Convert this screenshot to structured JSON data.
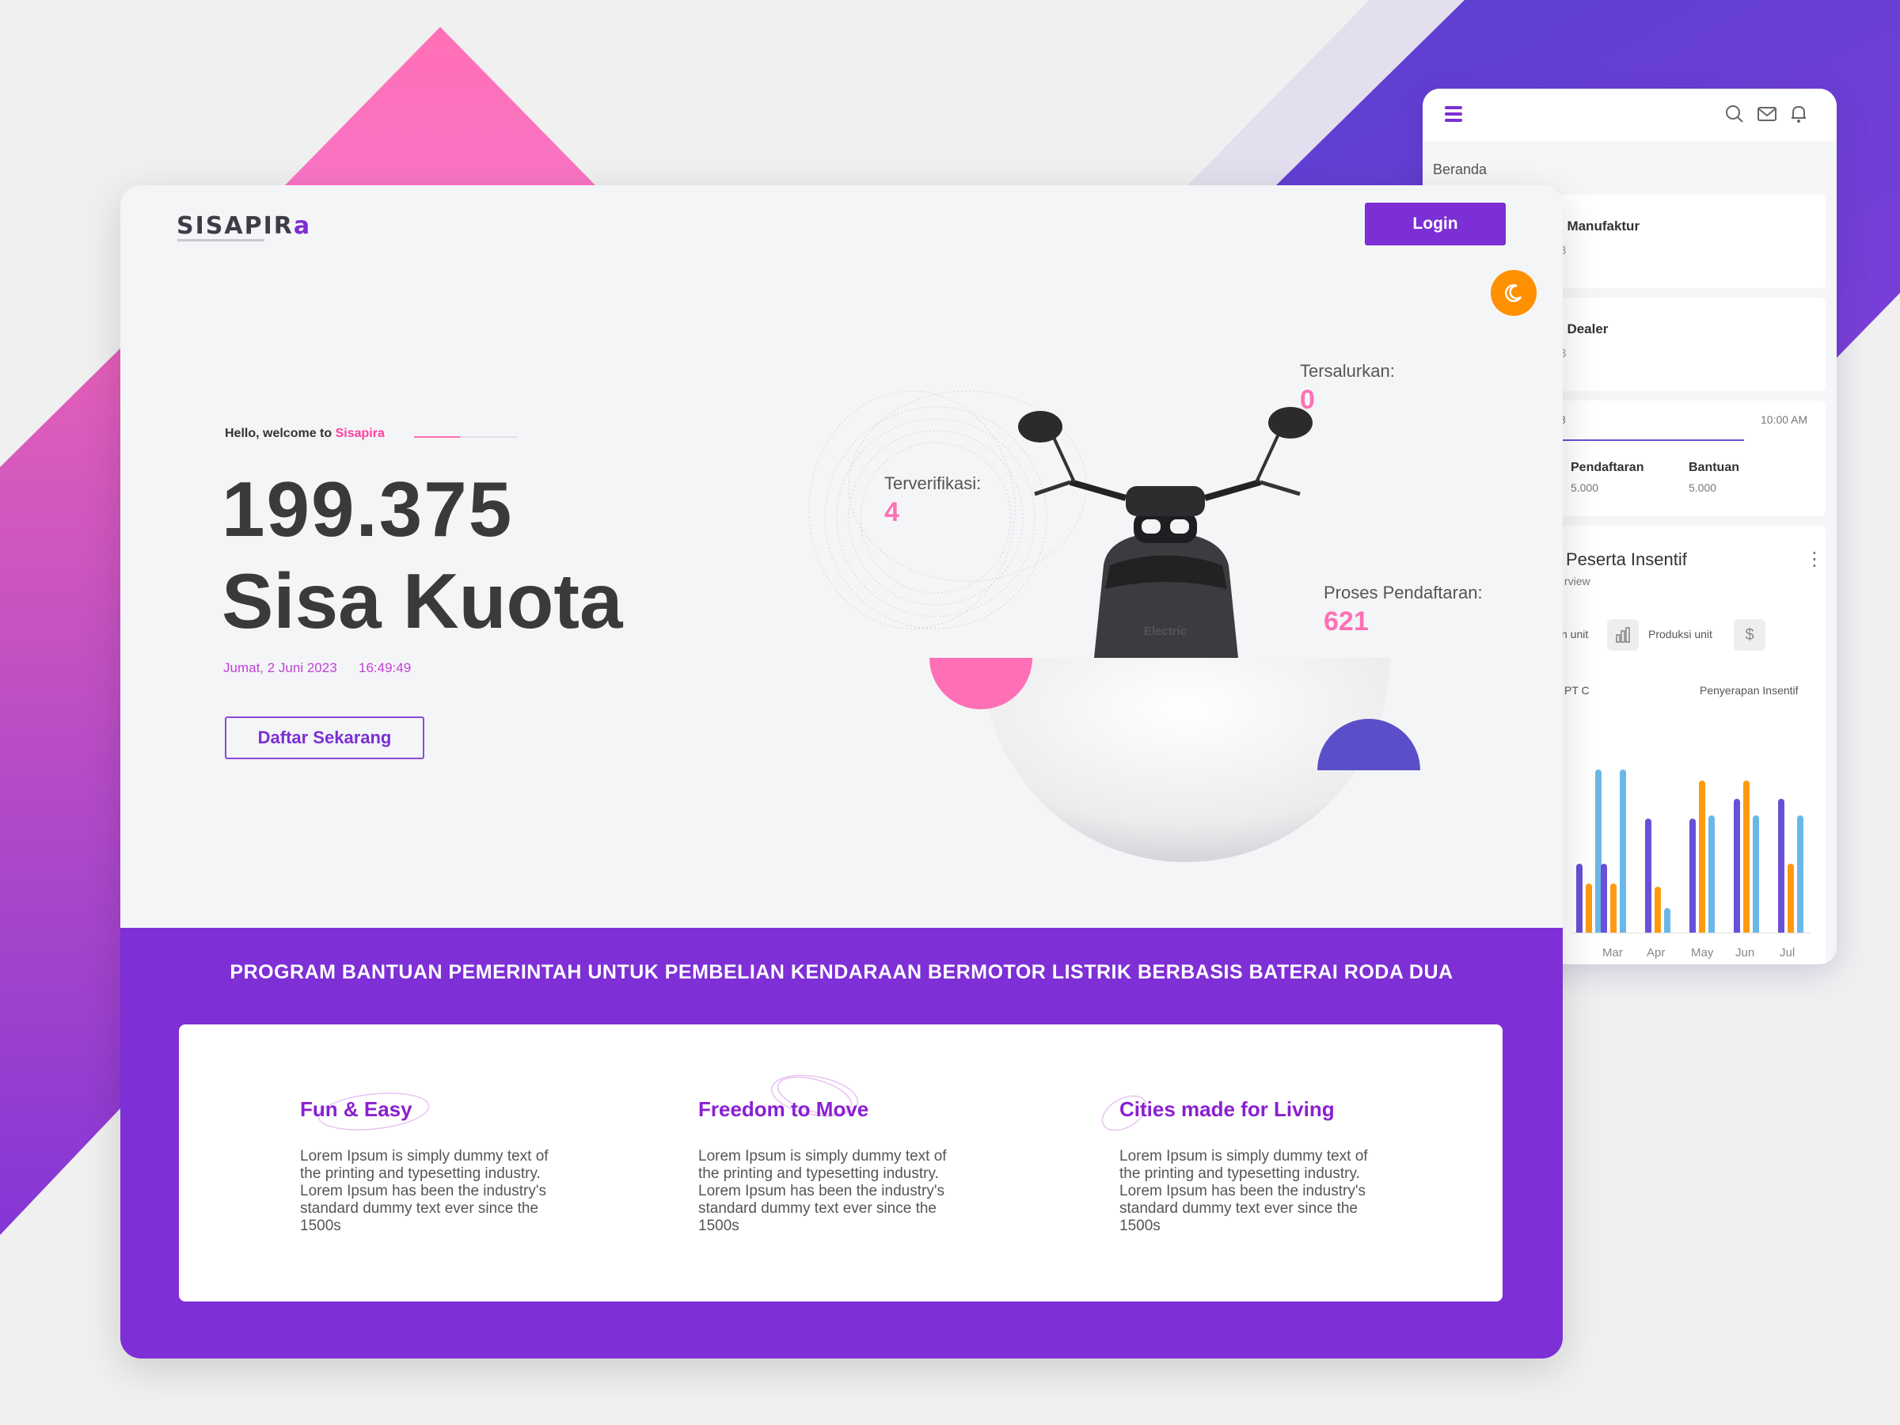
{
  "colors": {
    "primary": "#7e2fd6",
    "pink": "#ff6fb5",
    "orange": "#ff9000",
    "blue": "#5a4fc9",
    "cyan": "#6ab8e8"
  },
  "landing": {
    "logo_main": "SISAPIR",
    "logo_end": "a",
    "login_label": "Login",
    "theme_toggle_icon": "moon-icon",
    "hello_prefix": "Hello, welcome to ",
    "hello_name": "Sisapira",
    "quota_number": "199.375",
    "quota_label": "Sisa Kuota",
    "date": "Jumat, 2 Juni 2023",
    "time": "16:49:49",
    "cta_label": "Daftar Sekarang",
    "stats": {
      "verified_label": "Terverifikasi:",
      "verified_value": "4",
      "distributed_label": "Tersalurkan:",
      "distributed_value": "0",
      "process_label": "Proses Pendaftaran:",
      "process_value": "621"
    },
    "scooter_brand": "Electric",
    "band_title": "PROGRAM BANTUAN PEMERINTAH UNTUK PEMBELIAN KENDARAAN BERMOTOR LISTRIK BERBASIS BATERAI RODA DUA",
    "features": [
      {
        "title": "Fun & Easy",
        "body": "Lorem Ipsum is simply dummy text of the printing and typesetting industry. Lorem Ipsum has been the industry's standard dummy text ever since the 1500s"
      },
      {
        "title": "Freedom to Move",
        "body": "Lorem Ipsum is simply dummy text of the printing and typesetting industry. Lorem Ipsum has been the industry's standard dummy text ever since the 1500s"
      },
      {
        "title": "Cities made for Living",
        "body": "Lorem Ipsum is simply dummy text of the printing and typesetting industry. Lorem Ipsum has been the industry's standard dummy text ever since the 1500s"
      }
    ]
  },
  "dashboard": {
    "icons": [
      "menu-icon",
      "search-icon",
      "mail-icon",
      "bell-icon"
    ],
    "breadcrumb": "Beranda",
    "card1_title": "i Manufaktur",
    "card1_sub": "3",
    "card2_title": "i Dealer",
    "card2_sub": "3",
    "card3_left": "3",
    "card3_time": "10:00 AM",
    "pendaftaran_label": "Pendaftaran",
    "pendaftaran_value": "5.000",
    "bantuan_label": "Bantuan",
    "bantuan_value": "5.000",
    "chart_title": "Peserta Insentif",
    "chart_subtitle": "rview",
    "filter_left": "n unit",
    "filter_produksi": "Produksi unit",
    "legend_left": "PT C",
    "legend_right": "Penyerapan Insentif",
    "more_icon": "more-vertical-icon"
  },
  "chart_data": {
    "type": "bar",
    "categories": [
      "Mar",
      "Apr",
      "May",
      "Jun",
      "Jul"
    ],
    "series": [
      {
        "color": "#6a4fd8",
        "values": [
          42,
          70,
          70,
          82,
          82
        ]
      },
      {
        "color": "#ff9a10",
        "values": [
          30,
          28,
          93,
          93,
          42
        ]
      },
      {
        "color": "#6ab8e8",
        "values": [
          100,
          15,
          72,
          72,
          72
        ]
      }
    ],
    "partial_left_series": [
      {
        "color": "#6a4fd8",
        "value": 42
      },
      {
        "color": "#ff9a10",
        "value": 30
      },
      {
        "color": "#6ab8e8",
        "value": 100
      }
    ],
    "ylim": [
      0,
      100
    ]
  }
}
